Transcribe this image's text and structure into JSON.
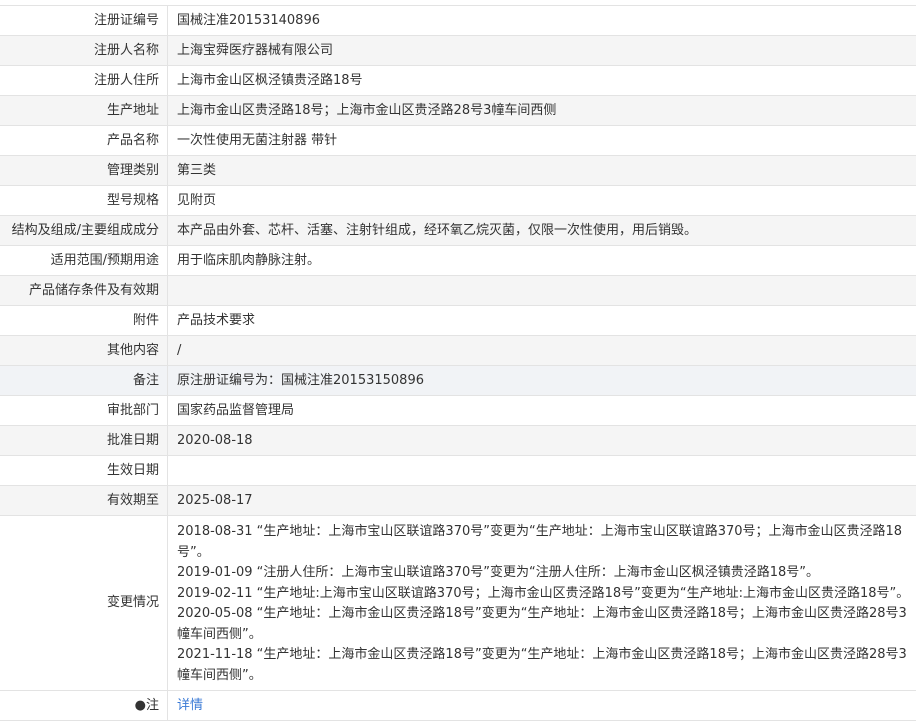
{
  "rows": [
    {
      "label": "注册证编号",
      "value": "国械注准20153140896"
    },
    {
      "label": "注册人名称",
      "value": "上海宝舜医疗器械有限公司"
    },
    {
      "label": "注册人住所",
      "value": "上海市金山区枫泾镇贵泾路18号"
    },
    {
      "label": "生产地址",
      "value": "上海市金山区贵泾路18号；上海市金山区贵泾路28号3幢车间西侧"
    },
    {
      "label": "产品名称",
      "value": "一次性使用无菌注射器 带针"
    },
    {
      "label": "管理类别",
      "value": "第三类"
    },
    {
      "label": "型号规格",
      "value": "见附页"
    },
    {
      "label": "结构及组成/主要组成成分",
      "value": "本产品由外套、芯杆、活塞、注射针组成，经环氧乙烷灭菌，仅限一次性使用，用后销毁。"
    },
    {
      "label": "适用范围/预期用途",
      "value": "用于临床肌肉静脉注射。"
    },
    {
      "label": "产品储存条件及有效期",
      "value": ""
    },
    {
      "label": "附件",
      "value": "产品技术要求"
    },
    {
      "label": "其他内容",
      "value": "/"
    },
    {
      "label": "备注",
      "value": "原注册证编号为：国械注准20153150896"
    },
    {
      "label": "审批部门",
      "value": "国家药品监督管理局"
    },
    {
      "label": "批准日期",
      "value": "2020-08-18"
    },
    {
      "label": "生效日期",
      "value": ""
    },
    {
      "label": "有效期至",
      "value": "2025-08-17"
    }
  ],
  "changes": {
    "label": "变更情况",
    "entries": [
      "2018-08-31 “生产地址：上海市宝山区联谊路370号”变更为“生产地址：上海市宝山区联谊路370号；上海市金山区贵泾路18号”。",
      "2019-01-09 “注册人住所：上海市宝山联谊路370号”变更为“注册人住所：上海市金山区枫泾镇贵泾路18号”。",
      "2019-02-11 “生产地址:上海市宝山区联谊路370号；上海市金山区贵泾路18号”变更为“生产地址:上海市金山区贵泾路18号”。",
      "2020-05-08 “生产地址：上海市金山区贵泾路18号”变更为“生产地址：上海市金山区贵泾路18号；上海市金山区贵泾路28号3幢车间西侧”。",
      "2021-11-18 “生产地址：上海市金山区贵泾路18号”变更为“生产地址：上海市金山区贵泾路18号；上海市金山区贵泾路28号3幢车间西侧”。"
    ]
  },
  "last_row": {
    "label": "●注",
    "link": "详情"
  }
}
